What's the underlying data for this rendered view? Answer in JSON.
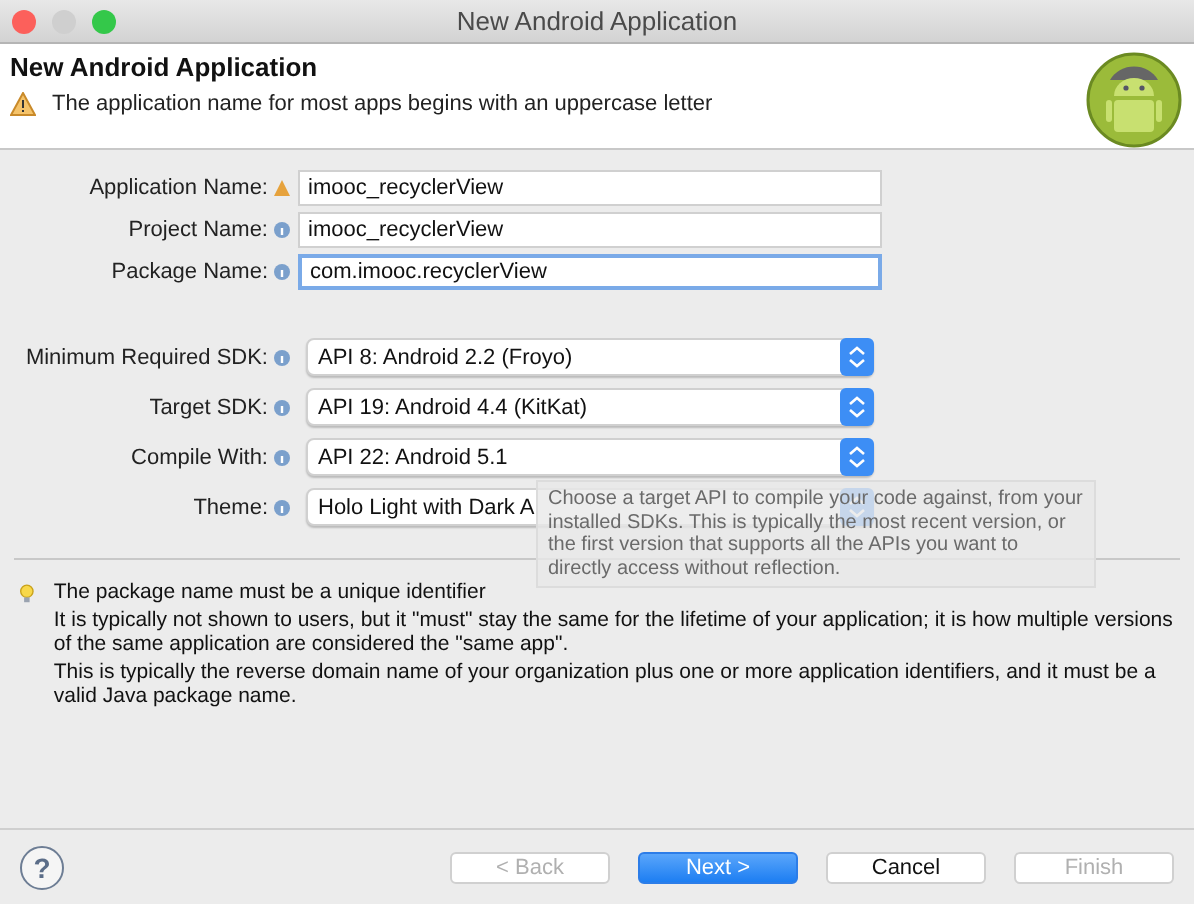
{
  "window": {
    "title": "New Android Application"
  },
  "header": {
    "title": "New Android Application",
    "message": "The application name for most apps begins with an uppercase letter"
  },
  "fields": [
    {
      "label": "Application Name:",
      "kind": "text",
      "warning": true,
      "value": "imooc_recyclerView",
      "focused": false
    },
    {
      "label": "Project Name:",
      "kind": "text",
      "warning": false,
      "value": "imooc_recyclerView",
      "focused": false
    },
    {
      "label": "Package Name:",
      "kind": "text",
      "warning": false,
      "value": "com.imooc.recyclerView",
      "focused": true
    },
    {
      "kind": "gap"
    },
    {
      "label": "Minimum Required SDK:",
      "kind": "select",
      "warning": false,
      "value": "API 8: Android 2.2 (Froyo)"
    },
    {
      "label": "Target SDK:",
      "kind": "select",
      "warning": false,
      "value": "API 19: Android 4.4 (KitKat)"
    },
    {
      "label": "Compile With:",
      "kind": "select",
      "warning": false,
      "value": "API 22: Android 5.1"
    },
    {
      "label": "Theme:",
      "kind": "select",
      "warning": false,
      "value": "Holo Light with Dark A"
    }
  ],
  "tooltip": "Choose a target API to compile your code against, from your installed SDKs. This is typically the most recent version, or the first version that supports all the APIs you want to directly access without reflection.",
  "description": [
    "The package name must be a unique identifier",
    "It is typically not shown to users, but it \"must\" stay the same for the lifetime of your application; it is how multiple versions of the same application are considered the \"same app\".",
    "This is typically the reverse domain name of your organization plus one or more application identifiers, and it must be a valid Java package name."
  ],
  "buttons": [
    {
      "label": "?",
      "kind": "help"
    },
    {
      "label": "< Back",
      "kind": "normal",
      "disabled": true
    },
    {
      "label": "Next >",
      "kind": "default",
      "disabled": false
    },
    {
      "label": "Cancel",
      "kind": "normal",
      "disabled": false
    },
    {
      "label": "Finish",
      "kind": "normal",
      "disabled": true
    }
  ]
}
